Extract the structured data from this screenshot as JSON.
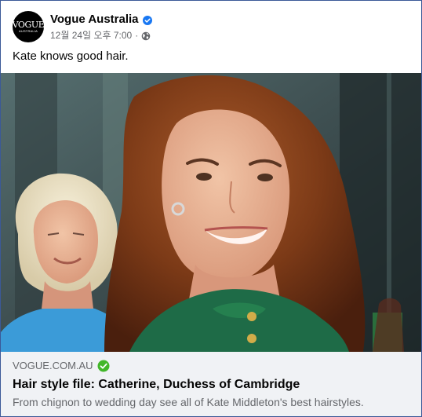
{
  "post": {
    "page_name": "Vogue Australia",
    "timestamp": "12월 24일 오후 7:00",
    "separator": "·",
    "caption": "Kate knows good hair.",
    "avatar": {
      "logo_text": "VOGUE",
      "logo_subtext": "AUSTRALIA"
    },
    "icons": {
      "verified": "verified-badge-icon",
      "audience": "globe-icon"
    },
    "colors": {
      "frame_border": "#3b5998",
      "verified_blue": "#1877f2",
      "link_check_green": "#42b72a",
      "link_box_bg": "#f0f2f5"
    }
  },
  "link_preview": {
    "domain": "VOGUE.COM.AU",
    "title": "Hair style file: Catherine, Duchess of Cambridge",
    "description": "From chignon to wedding day see all of Kate Middleton's best hairstyles."
  }
}
